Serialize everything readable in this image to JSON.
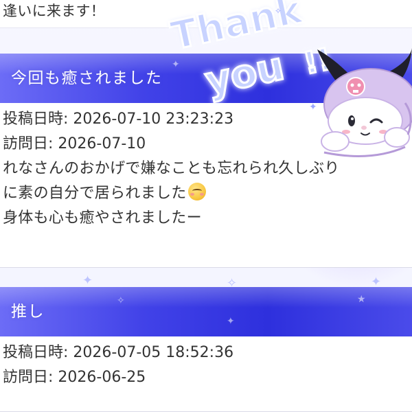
{
  "top_fragment": {
    "text": "逢いに来ます！"
  },
  "entries": [
    {
      "title": "今回も癒されました",
      "posted_label": "投稿日時:",
      "posted_value": "2026-07-10 23:23:23",
      "visit_label": "訪問日:",
      "visit_value": "2026-07-10",
      "comment_lines": [
        "れなさんのおかげで嫌なことも忘れられ久しぶり",
        "に素の自分で居られました",
        "身体も心も癒やされましたー"
      ],
      "emoji": "relieved-smile-emoji"
    },
    {
      "title": "推し",
      "posted_label": "投稿日時:",
      "posted_value": "2026-07-05 18:52:36",
      "visit_label": "訪問日:",
      "visit_value": "2026-06-25"
    }
  ],
  "sticker": {
    "text_line1": "Thank",
    "text_line2": "you",
    "text_line3": "!!",
    "character": "kuromi-character",
    "colors": {
      "text_fill": "#c8d3ff",
      "text_stroke": "#ffffff",
      "glow": "#8f9cff",
      "character_hood": "#d8c4ef",
      "character_hood_shadow": "#b59ad8",
      "skull_pink": "#f08fb0"
    }
  },
  "colors": {
    "header_gradient_start": "#6c6cf6",
    "header_gradient_mid": "#2e30dd",
    "header_text": "#ffffff",
    "body_text": "#333333",
    "page_bg": "#f5f5ff"
  }
}
